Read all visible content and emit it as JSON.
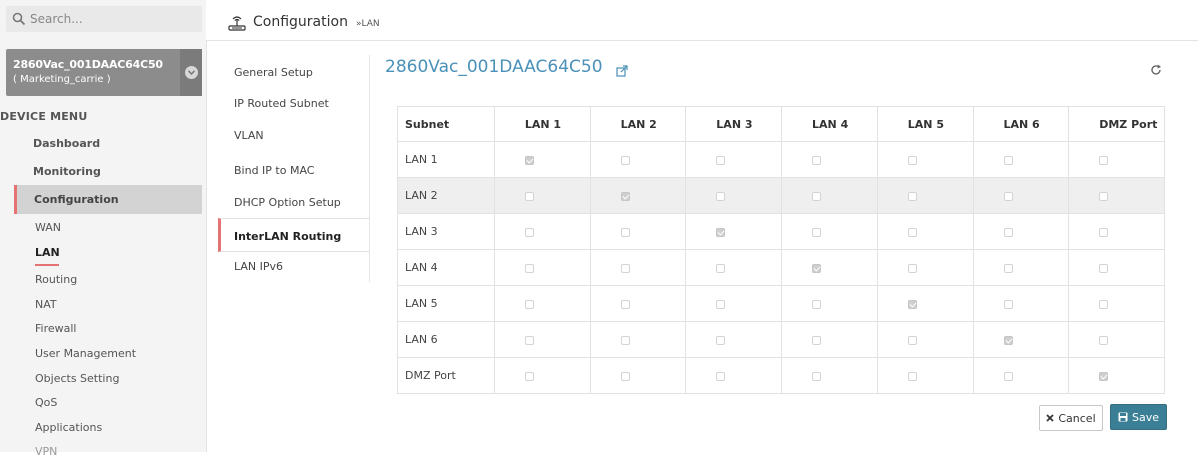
{
  "search": {
    "placeholder": "Search..."
  },
  "device": {
    "name": "2860Vac_001DAAC64C50",
    "profile": "( Marketing_carrie )"
  },
  "menu": {
    "header": "DEVICE MENU",
    "items": [
      "Dashboard",
      "Monitoring",
      "Configuration"
    ],
    "active": "Configuration",
    "submenu": [
      "WAN",
      "LAN",
      "Routing",
      "NAT",
      "Firewall",
      "User Management",
      "Objects Setting",
      "QoS",
      "Applications",
      "VPN"
    ],
    "current_submenu": "LAN"
  },
  "header": {
    "title": "Configuration",
    "crumb": "»LAN"
  },
  "subnav": {
    "items": [
      "General Setup",
      "IP Routed Subnet",
      "VLAN",
      "Bind IP to MAC",
      "DHCP Option Setup",
      "InterLAN Routing",
      "LAN IPv6"
    ],
    "active": "InterLAN Routing"
  },
  "content": {
    "device_title": "2860Vac_001DAAC64C50",
    "table": {
      "headers": [
        "Subnet",
        "LAN 1",
        "LAN 2",
        "LAN 3",
        "LAN 4",
        "LAN 5",
        "LAN 6",
        "DMZ Port"
      ],
      "rows": [
        {
          "label": "LAN 1",
          "checks": [
            true,
            false,
            false,
            false,
            false,
            false,
            false
          ]
        },
        {
          "label": "LAN 2",
          "checks": [
            false,
            true,
            false,
            false,
            false,
            false,
            false
          ]
        },
        {
          "label": "LAN 3",
          "checks": [
            false,
            false,
            true,
            false,
            false,
            false,
            false
          ]
        },
        {
          "label": "LAN 4",
          "checks": [
            false,
            false,
            false,
            true,
            false,
            false,
            false
          ]
        },
        {
          "label": "LAN 5",
          "checks": [
            false,
            false,
            false,
            false,
            true,
            false,
            false
          ]
        },
        {
          "label": "LAN 6",
          "checks": [
            false,
            false,
            false,
            false,
            false,
            true,
            false
          ]
        },
        {
          "label": "DMZ Port",
          "checks": [
            false,
            false,
            false,
            false,
            false,
            false,
            true
          ]
        }
      ]
    }
  },
  "buttons": {
    "cancel": "Cancel",
    "save": "Save"
  },
  "colors": {
    "accent": "#e57373",
    "title_blue": "#4a90b8",
    "save_bg": "#3a7f95",
    "device_bg": "#8c8c8c"
  }
}
